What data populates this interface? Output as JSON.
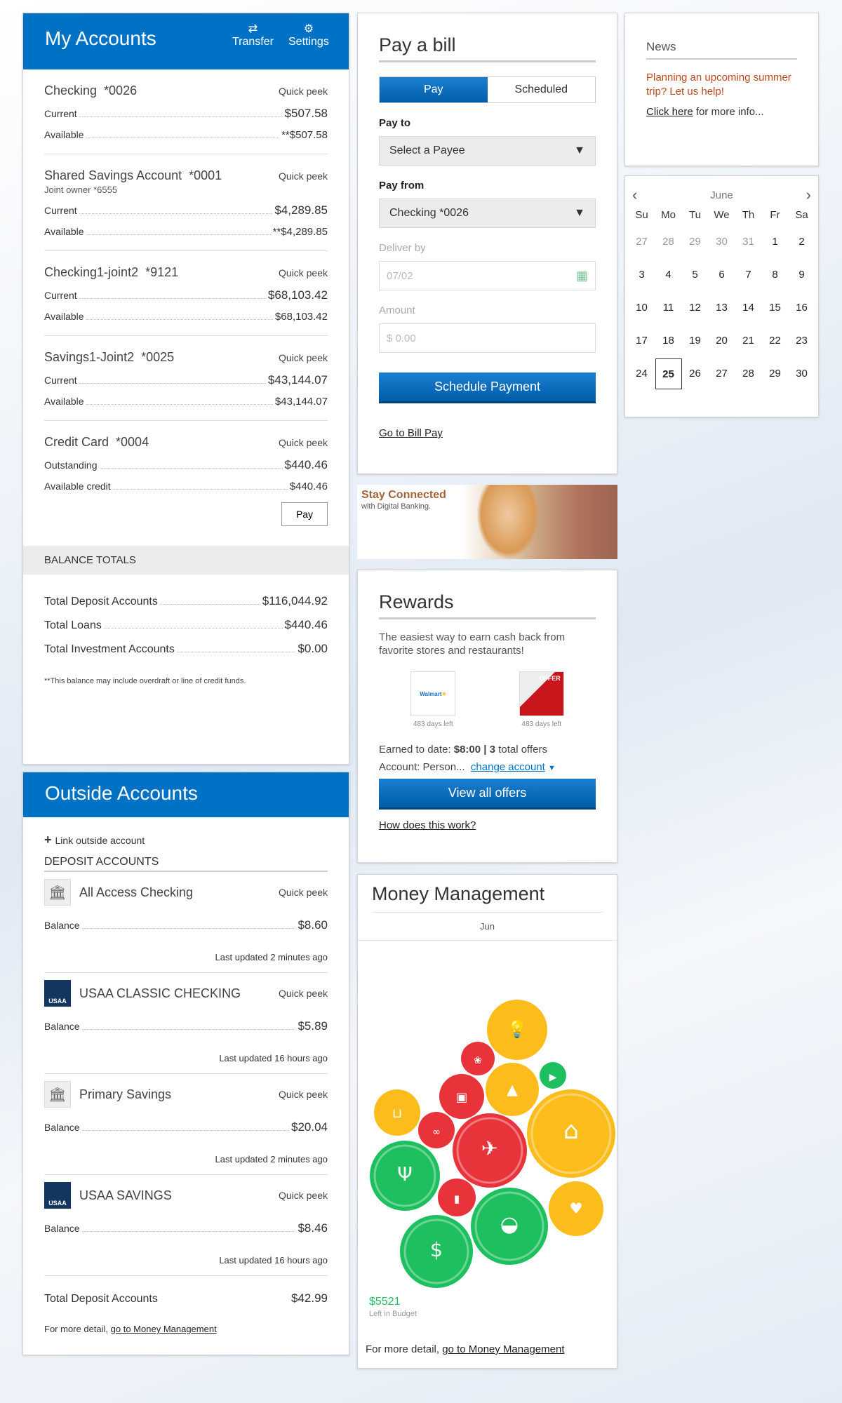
{
  "my_accounts": {
    "title": "My Accounts",
    "transfer": "Transfer",
    "settings": "Settings",
    "accounts": [
      {
        "name": "Checking  *0026",
        "sub": "",
        "quick_peek": "Quick peek",
        "rows": [
          {
            "label": "Current",
            "value": "$507.58"
          },
          {
            "label": "Available",
            "value": "**$507.58"
          }
        ]
      },
      {
        "name": "Shared Savings Account  *0001",
        "sub": "Joint owner *6555",
        "quick_peek": "Quick peek",
        "rows": [
          {
            "label": "Current",
            "value": "$4,289.85"
          },
          {
            "label": "Available",
            "value": "**$4,289.85"
          }
        ]
      },
      {
        "name": "Checking1-joint2  *9121",
        "sub": "",
        "quick_peek": "Quick peek",
        "rows": [
          {
            "label": "Current",
            "value": "$68,103.42"
          },
          {
            "label": "Available",
            "value": "$68,103.42"
          }
        ]
      },
      {
        "name": "Savings1-Joint2  *0025",
        "sub": "",
        "quick_peek": "Quick peek",
        "rows": [
          {
            "label": "Current",
            "value": "$43,144.07"
          },
          {
            "label": "Available",
            "value": "$43,144.07"
          }
        ]
      },
      {
        "name": "Credit Card  *0004",
        "sub": "",
        "quick_peek": "Quick peek",
        "rows": [
          {
            "label": "Outstanding",
            "value": "$440.46"
          },
          {
            "label": "Available credit",
            "value": "$440.46"
          }
        ],
        "pay": "Pay"
      }
    ],
    "totals_title": "BALANCE TOTALS",
    "totals": [
      {
        "label": "Total Deposit Accounts",
        "value": "$116,044.92"
      },
      {
        "label": "Total Loans",
        "value": "$440.46"
      },
      {
        "label": "Total Investment Accounts",
        "value": "$0.00"
      }
    ],
    "note": "**This balance may include overdraft or line of credit funds."
  },
  "outside": {
    "title": "Outside Accounts",
    "link": "Link outside account",
    "section": "DEPOSIT ACCOUNTS",
    "accounts": [
      {
        "name": "All Access Checking",
        "icon": "bank-icon",
        "quick_peek": "Quick peek",
        "label": "Balance",
        "value": "$8.60",
        "updated": "Last updated 2 minutes ago"
      },
      {
        "name": "USAA CLASSIC CHECKING",
        "icon": "usaa-logo",
        "quick_peek": "Quick peek",
        "label": "Balance",
        "value": "$5.89",
        "updated": "Last updated 16 hours ago"
      },
      {
        "name": "Primary Savings",
        "icon": "bank-icon",
        "quick_peek": "Quick peek",
        "label": "Balance",
        "value": "$20.04",
        "updated": "Last updated 2 minutes ago"
      },
      {
        "name": "USAA SAVINGS",
        "icon": "usaa-logo",
        "quick_peek": "Quick peek",
        "label": "Balance",
        "value": "$8.46",
        "updated": "Last updated 16 hours ago"
      }
    ],
    "total_label": "Total Deposit Accounts",
    "total_value": "$42.99",
    "more": "For more detail, ",
    "more_link": "go to Money Management"
  },
  "pay_bill": {
    "title": "Pay a bill",
    "tab_pay": "Pay",
    "tab_scheduled": "Scheduled",
    "pay_to": "Pay to",
    "payee": "Select a Payee",
    "pay_from": "Pay from",
    "from_value": "Checking *0026",
    "deliver_by": "Deliver by",
    "deliver_value": "07/02",
    "amount": "Amount",
    "amount_placeholder": "$ 0.00",
    "schedule": "Schedule Payment",
    "go_link": "Go to Bill Pay"
  },
  "banner": {
    "title": "Stay Connected",
    "subtitle": "with Digital Banking."
  },
  "rewards": {
    "title": "Rewards",
    "desc": "The easiest way to earn cash back from favorite stores and restaurants!",
    "offers": [
      {
        "logo": "Walmart",
        "days": "483 days left"
      },
      {
        "logo": "OFFER",
        "days": "483 days left"
      }
    ],
    "earned_label": "Earned to date: ",
    "earned": "$8:00",
    "sep": " | ",
    "offers_count": "3",
    "offers_suffix": " total offers",
    "account_label": "Account: Person...",
    "change": "change account",
    "view_all": "View all offers",
    "how": "How does this work?"
  },
  "money": {
    "title": "Money Management",
    "month": "Jun",
    "left_value": "$5521",
    "left_label": "Left in Budget",
    "more": "For more detail, ",
    "more_link": "go to Money Management",
    "colors": {
      "green": "#1dbf5e",
      "yellow": "#fbbc1c",
      "red": "#e8333a"
    },
    "bubbles": [
      {
        "icon": "lightbulb-icon",
        "status": "yellow"
      },
      {
        "icon": "paw-icon",
        "status": "red"
      },
      {
        "icon": "graduation-cap-icon",
        "status": "yellow"
      },
      {
        "icon": "video-camera-icon",
        "status": "green"
      },
      {
        "icon": "gift-icon",
        "status": "red"
      },
      {
        "icon": "shopping-cart-icon",
        "status": "yellow"
      },
      {
        "icon": "bicycle-icon",
        "status": "red"
      },
      {
        "icon": "house-icon",
        "status": "yellow"
      },
      {
        "icon": "airplane-icon",
        "status": "red"
      },
      {
        "icon": "fork-knife-icon",
        "status": "green"
      },
      {
        "icon": "toothbrush-icon",
        "status": "red"
      },
      {
        "icon": "car-icon",
        "status": "green"
      },
      {
        "icon": "heart-pulse-icon",
        "status": "yellow"
      },
      {
        "icon": "dollar-icon",
        "status": "green"
      }
    ]
  },
  "news": {
    "title": "News",
    "headline": "Planning an upcoming summer trip? Let us help!",
    "link": "Click here",
    "link_suffix": " for more info..."
  },
  "calendar": {
    "month": "June",
    "weekdays": [
      "Su",
      "Mo",
      "Tu",
      "We",
      "Th",
      "Fr",
      "Sa"
    ],
    "weeks": [
      [
        "27",
        "28",
        "29",
        "30",
        "31",
        "1",
        "2"
      ],
      [
        "3",
        "4",
        "5",
        "6",
        "7",
        "8",
        "9"
      ],
      [
        "10",
        "11",
        "12",
        "13",
        "14",
        "15",
        "16"
      ],
      [
        "17",
        "18",
        "19",
        "20",
        "21",
        "22",
        "23"
      ],
      [
        "24",
        "25",
        "26",
        "27",
        "28",
        "29",
        "30"
      ]
    ],
    "today": "25"
  },
  "accent": "#0072c6"
}
